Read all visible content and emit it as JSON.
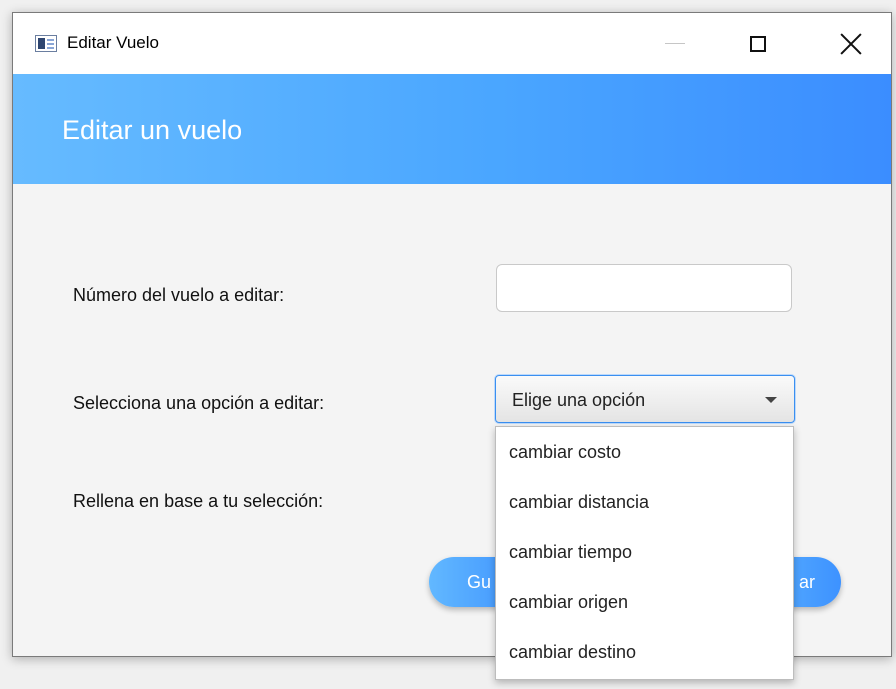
{
  "window": {
    "title": "Editar Vuelo"
  },
  "banner": {
    "title": "Editar un vuelo"
  },
  "form": {
    "flight_number_label": "Número del vuelo a editar:",
    "flight_number_value": "",
    "option_label": "Selecciona una opción a editar:",
    "option_selected": "Elige una opción",
    "fill_label": "Rellena en base a tu selección:"
  },
  "buttons": {
    "save_label_visible": "Gu",
    "cancel_label_visible": "ar"
  },
  "dropdown": {
    "options": [
      "cambiar costo",
      "cambiar distancia",
      "cambiar tiempo",
      "cambiar origen",
      "cambiar destino"
    ]
  },
  "colors": {
    "banner_start": "#66bbff",
    "banner_end": "#3b8dff",
    "focus_border": "#3a8ff0"
  }
}
